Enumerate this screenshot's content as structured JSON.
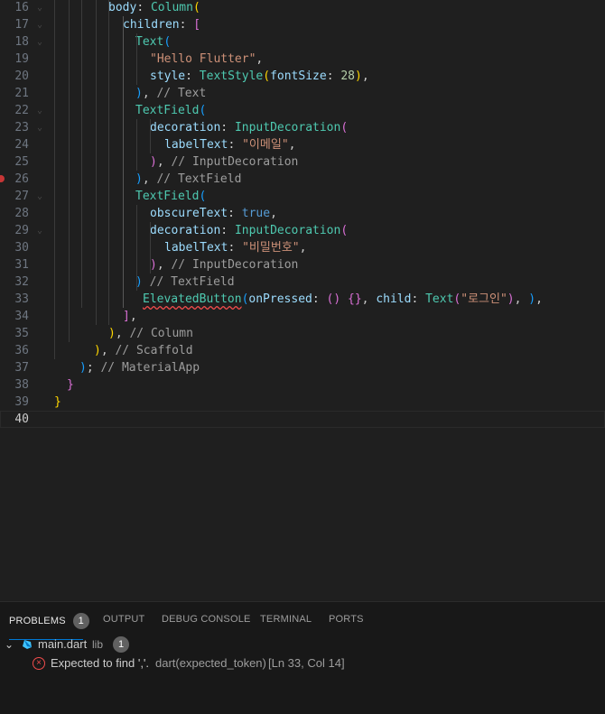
{
  "editor": {
    "lines": [
      {
        "n": "16",
        "tokens": [
          [
            "kw",
            "body"
          ],
          [
            "pl",
            ": "
          ],
          [
            "cls",
            "Column"
          ],
          [
            "p1",
            "("
          ]
        ]
      },
      {
        "n": "17",
        "tokens": [
          [
            "kw",
            "children"
          ],
          [
            "pl",
            ": "
          ],
          [
            "p2",
            "["
          ]
        ]
      },
      {
        "n": "18",
        "tokens": [
          [
            "cls",
            "Text"
          ],
          [
            "p3",
            "("
          ]
        ]
      },
      {
        "n": "19",
        "tokens": [
          [
            "str",
            "\"Hello Flutter\""
          ],
          [
            "pl",
            ","
          ]
        ]
      },
      {
        "n": "20",
        "tokens": [
          [
            "kw",
            "style"
          ],
          [
            "pl",
            ": "
          ],
          [
            "cls",
            "TextStyle"
          ],
          [
            "p1",
            "("
          ],
          [
            "kw",
            "fontSize"
          ],
          [
            "pl",
            ": "
          ],
          [
            "num",
            "28"
          ],
          [
            "p1",
            ")"
          ],
          [
            "pl",
            ","
          ]
        ]
      },
      {
        "n": "21",
        "tokens": [
          [
            "p3",
            ")"
          ],
          [
            "pl",
            ", "
          ],
          [
            "cm",
            "// Text"
          ]
        ]
      },
      {
        "n": "22",
        "tokens": [
          [
            "cls",
            "TextField"
          ],
          [
            "p3",
            "("
          ]
        ]
      },
      {
        "n": "23",
        "tokens": [
          [
            "kw",
            "decoration"
          ],
          [
            "pl",
            ": "
          ],
          [
            "cls",
            "InputDecoration"
          ],
          [
            "p2",
            "("
          ]
        ]
      },
      {
        "n": "24",
        "tokens": [
          [
            "kw",
            "labelText"
          ],
          [
            "pl",
            ": "
          ],
          [
            "str",
            "\"이메일\""
          ],
          [
            "pl",
            ","
          ]
        ]
      },
      {
        "n": "25",
        "tokens": [
          [
            "p2",
            ")"
          ],
          [
            "pl",
            ", "
          ],
          [
            "cm",
            "// InputDecoration"
          ]
        ]
      },
      {
        "n": "26",
        "tokens": [
          [
            "p3",
            ")"
          ],
          [
            "pl",
            ", "
          ],
          [
            "cm",
            "// TextField"
          ]
        ]
      },
      {
        "n": "27",
        "tokens": [
          [
            "cls",
            "TextField"
          ],
          [
            "p3",
            "("
          ]
        ]
      },
      {
        "n": "28",
        "tokens": [
          [
            "kw",
            "obscureText"
          ],
          [
            "pl",
            ": "
          ],
          [
            "bool",
            "true"
          ],
          [
            "pl",
            ","
          ]
        ]
      },
      {
        "n": "29",
        "tokens": [
          [
            "kw",
            "decoration"
          ],
          [
            "pl",
            ": "
          ],
          [
            "cls",
            "InputDecoration"
          ],
          [
            "p2",
            "("
          ]
        ]
      },
      {
        "n": "30",
        "tokens": [
          [
            "kw",
            "labelText"
          ],
          [
            "pl",
            ": "
          ],
          [
            "str",
            "\"비밀번호\""
          ],
          [
            "pl",
            ","
          ]
        ]
      },
      {
        "n": "31",
        "tokens": [
          [
            "p2",
            ")"
          ],
          [
            "pl",
            ", "
          ],
          [
            "cm",
            "// InputDecoration"
          ]
        ]
      },
      {
        "n": "32",
        "tokens": [
          [
            "p3",
            ")"
          ],
          [
            "pl",
            " "
          ],
          [
            "cm",
            "// TextField"
          ]
        ]
      },
      {
        "n": "33",
        "tokens": [
          [
            "cls",
            "ElevatedButton"
          ],
          [
            "p3",
            "("
          ],
          [
            "kw",
            "onPressed"
          ],
          [
            "pl",
            ": "
          ],
          [
            "p2",
            "()"
          ],
          [
            "pl",
            " "
          ],
          [
            "p2",
            "{}"
          ],
          [
            "pl",
            ", "
          ],
          [
            "kw",
            "child"
          ],
          [
            "pl",
            ": "
          ],
          [
            "cls",
            "Text"
          ],
          [
            "p2",
            "("
          ],
          [
            "str",
            "\"로그인\""
          ],
          [
            "p2",
            ")"
          ],
          [
            "pl",
            ", "
          ],
          [
            "p3",
            ")"
          ],
          [
            "pl",
            ","
          ]
        ]
      },
      {
        "n": "34",
        "tokens": [
          [
            "p2",
            "]"
          ],
          [
            "pl",
            ","
          ]
        ]
      },
      {
        "n": "35",
        "tokens": [
          [
            "p1",
            ")"
          ],
          [
            "pl",
            ", "
          ],
          [
            "cm",
            "// Column"
          ]
        ]
      },
      {
        "n": "36",
        "tokens": [
          [
            "p1",
            ")"
          ],
          [
            "pl",
            ", "
          ],
          [
            "cm",
            "// Scaffold"
          ]
        ]
      },
      {
        "n": "37",
        "tokens": [
          [
            "p3",
            ")"
          ],
          [
            "pl",
            "; "
          ],
          [
            "cm",
            "// MaterialApp"
          ]
        ]
      },
      {
        "n": "38",
        "tokens": [
          [
            "p2",
            "}"
          ]
        ]
      },
      {
        "n": "39",
        "tokens": [
          [
            "p1",
            "}"
          ]
        ]
      },
      {
        "n": "40",
        "tokens": []
      }
    ]
  },
  "panel": {
    "tabs": [
      {
        "label": "PROBLEMS",
        "badge": "1",
        "active": true
      },
      {
        "label": "OUTPUT"
      },
      {
        "label": "DEBUG CONSOLE"
      },
      {
        "label": "TERMINAL"
      },
      {
        "label": "PORTS"
      }
    ],
    "file": {
      "name": "main.dart",
      "folder": "lib",
      "count": "1"
    },
    "problem": {
      "message": "Expected to find ','.",
      "source": "dart(expected_token)",
      "location": "[Ln 33, Col 14]"
    }
  }
}
